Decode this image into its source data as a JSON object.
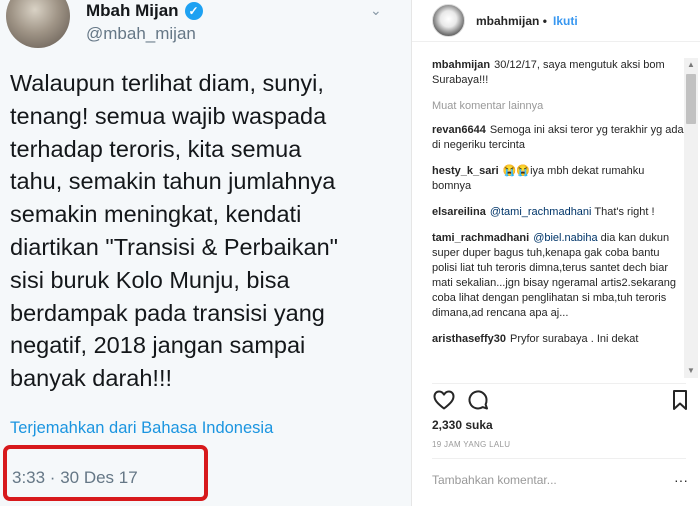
{
  "tweet": {
    "display_name": "Mbah Mijan",
    "handle": "@mbah_mijan",
    "verified_icon": "check",
    "body": "Walaupun terlihat diam, sunyi,\ntenang! semua wajib waspada\nterhadap teroris, kita semua\ntahu, semakin tahun jumlahnya\nsemakin meningkat, kendati\ndiartikan \"Transisi & Perbaikan\"\nsisi buruk Kolo Munju, bisa\nberdampak pada transisi yang\nnegatif, 2018 jangan sampai\nbanyak darah!!!",
    "translate_link": "Terjemahkan dari Bahasa Indonesia",
    "timestamp": "3:33 · 30 Des 17",
    "highlight_color": "#d7191c"
  },
  "instagram": {
    "username": "mbahmijan",
    "dot": "•",
    "follow_label": "Ikuti",
    "caption": {
      "user": "mbahmijan",
      "text": "30/12/17, saya mengutuk aksi bom Surabaya!!!"
    },
    "load_more": "Muat komentar lainnya",
    "comments": [
      {
        "user": "revan6644",
        "mention": "",
        "text": "Semoga ini aksi teror yg terakhir yg ada di negeriku tercinta"
      },
      {
        "user": "hesty_k_sari",
        "mention": "",
        "text": "😭😭iya mbh dekat rumahku bomnya"
      },
      {
        "user": "elsareilina",
        "mention": "@tami_rachmadhani",
        "text": "That's right !"
      },
      {
        "user": "tami_rachmadhani",
        "mention": "@biel.nabiha",
        "text": "dia kan dukun super duper bagus tuh,kenapa gak coba bantu polisi liat tuh teroris dimna,terus santet dech biar mati sekalian...jgn bisay ngeramal artis2.sekarang coba lihat dengan penglihatan si mba,tuh teroris dimana,ad rencana apa aj..."
      },
      {
        "user": "aristhaseffy30",
        "mention": "",
        "text": "Pryfor surabaya . Ini dekat"
      }
    ],
    "likes": "2,330 suka",
    "time_ago": "19 JAM YANG LALU",
    "comment_placeholder": "Tambahkan komentar...",
    "more_dots": "···",
    "icons": {
      "like": "heart-icon",
      "comment": "comment-icon",
      "save": "bookmark-icon"
    }
  }
}
